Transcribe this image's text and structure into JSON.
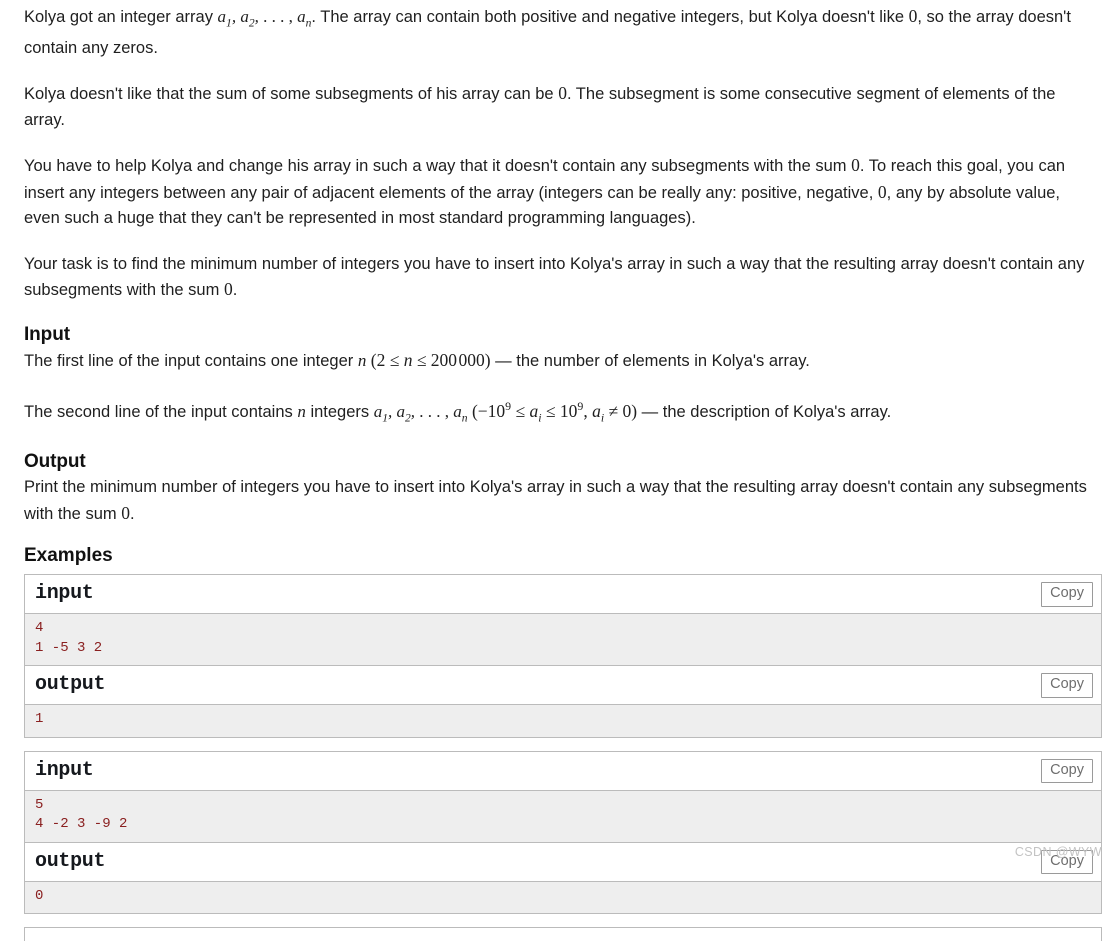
{
  "statement": {
    "paragraphs": [
      {
        "id": "p1",
        "segments": [
          {
            "t": "text",
            "v": "Kolya got an integer array "
          },
          {
            "t": "math",
            "v": "a₁, a₂, … , aₙ"
          },
          {
            "t": "text",
            "v": ". The array can contain both positive and negative integers, but Kolya doesn't like "
          },
          {
            "t": "math",
            "v": "0"
          },
          {
            "t": "text",
            "v": ", so the array doesn't contain any zeros."
          }
        ],
        "plain": "Kolya got an integer array a1, a2, ..., an. The array can contain both positive and negative integers, but Kolya doesn't like 0, so the array doesn't contain any zeros."
      },
      {
        "id": "p2",
        "plain": "Kolya doesn't like that the sum of some subsegments of his array can be 0. The subsegment is some consecutive segment of elements of the array."
      },
      {
        "id": "p3",
        "plain": "You have to help Kolya and change his array in such a way that it doesn't contain any subsegments with the sum 0. To reach this goal, you can insert any integers between any pair of adjacent elements of the array (integers can be really any: positive, negative, 0, any by absolute value, even such a huge that they can't be represented in most standard programming languages)."
      },
      {
        "id": "p4",
        "plain": "Your task is to find the minimum number of integers you have to insert into Kolya's array in such a way that the resulting array doesn't contain any subsegments with the sum 0."
      }
    ],
    "p1_a": "Kolya got an integer array ",
    "p1_math1": "a",
    "p1_b": ". The array can contain both positive and negative integers, but Kolya doesn't like ",
    "p1_zero": "0",
    "p1_c": ", so the array doesn't contain any zeros.",
    "p2_a": "Kolya doesn't like that the sum of some subsegments of his array can be ",
    "p2_zero": "0",
    "p2_b": ". The subsegment is some consecutive segment of elements of the array.",
    "p3_a": "You have to help Kolya and change his array in such a way that it doesn't contain any subsegments with the sum ",
    "p3_zero1": "0",
    "p3_b": ". To reach this goal, you can insert any integers between any pair of adjacent elements of the array (integers can be really any: positive, negative, ",
    "p3_zero2": "0",
    "p3_c": ", any by absolute value, even such a huge that they can't be represented in most standard programming languages).",
    "p4_a": "Your task is to find the minimum number of integers you have to insert into Kolya's array in such a way that the resulting array doesn't contain any subsegments with the sum ",
    "p4_zero": "0",
    "p4_b": "."
  },
  "input_section": {
    "heading": "Input",
    "line1_a": "The first line of the input contains one integer ",
    "line1_n": "n",
    "line1_constraint_open": "(",
    "line1_constraint": "2 ≤ n ≤ 200 000",
    "line1_constraint_close": ")",
    "line1_b": " — the number of elements in Kolya's array.",
    "line2_a": "The second line of the input contains ",
    "line2_n": "n",
    "line2_b": " integers ",
    "line2_array": "a₁, a₂, … , aₙ",
    "line2_constraint": "(−10⁹ ≤ aᵢ ≤ 10⁹, aᵢ ≠ 0)",
    "line2_c": " — the description of Kolya's array."
  },
  "output_section": {
    "heading": "Output",
    "text_a": "Print the minimum number of integers you have to insert into Kolya's array in such a way that the resulting array doesn't contain any subsegments with the sum ",
    "text_zero": "0",
    "text_b": "."
  },
  "examples": {
    "heading": "Examples",
    "copy_label": "Copy",
    "input_label": "input",
    "output_label": "output",
    "tests": [
      {
        "input": "4\n1 -5 3 2",
        "output": "1"
      },
      {
        "input": "5\n4 -2 3 -9 2",
        "output": "0"
      }
    ]
  },
  "watermark": {
    "text": "CSDN @WYW"
  },
  "colors": {
    "body_text": "#1f1f1f",
    "sample_text": "#8a2020",
    "sample_bg": "#eeeeee",
    "border": "#bbbbbb",
    "copy_border": "#9a9a9a",
    "copy_text": "#6e6e6e",
    "watermark": "#c3c3c3"
  }
}
